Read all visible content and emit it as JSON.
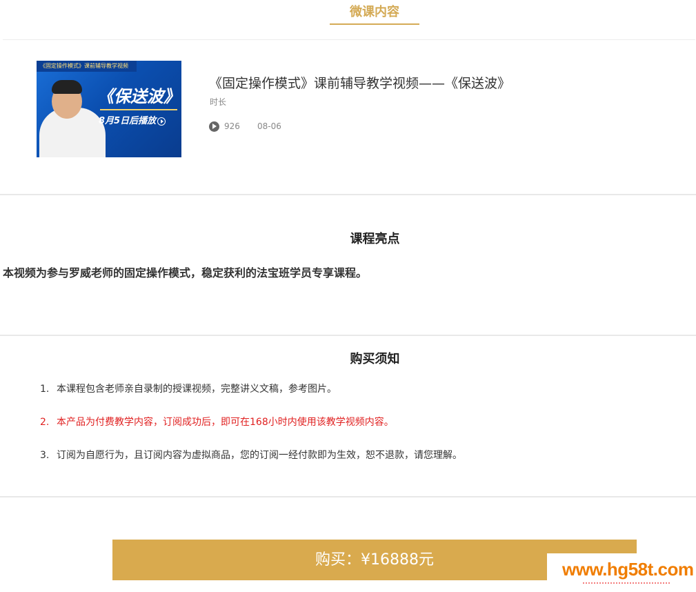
{
  "header": {
    "tab_title": "微课内容"
  },
  "course": {
    "thumbnail": {
      "banner_text": "《固定操作模式》课前辅导教学视频",
      "big_title": "《保送波》",
      "subtitle": "8月5日后播放"
    },
    "title": "《固定操作模式》课前辅导教学视频——《保送波》",
    "duration_label": "时长",
    "views": "926",
    "date": "08-06"
  },
  "highlights": {
    "title": "课程亮点",
    "text": "本视频为参与罗威老师的固定操作模式，稳定获利的法宝班学员专享课程。"
  },
  "notice": {
    "title": "购买须知",
    "items": [
      {
        "num": "1.",
        "text": "本课程包含老师亲自录制的授课视频，完整讲义文稿，参考图片。"
      },
      {
        "num": "2.",
        "text": "本产品为付费教学内容，订阅成功后，即可在168小时内使用该教学视频内容。"
      },
      {
        "num": "3.",
        "text": "订阅为自愿行为，且订阅内容为虚拟商品，您的订阅一经付款即为生效，恕不退款，请您理解。"
      }
    ]
  },
  "buy": {
    "label": "购买：¥16888元"
  },
  "watermark": {
    "text": "www.hg58t.com"
  },
  "colors": {
    "accent_gold": "#d4aa55",
    "button_gold": "#d9aa4e",
    "alert_red": "#e02020"
  }
}
